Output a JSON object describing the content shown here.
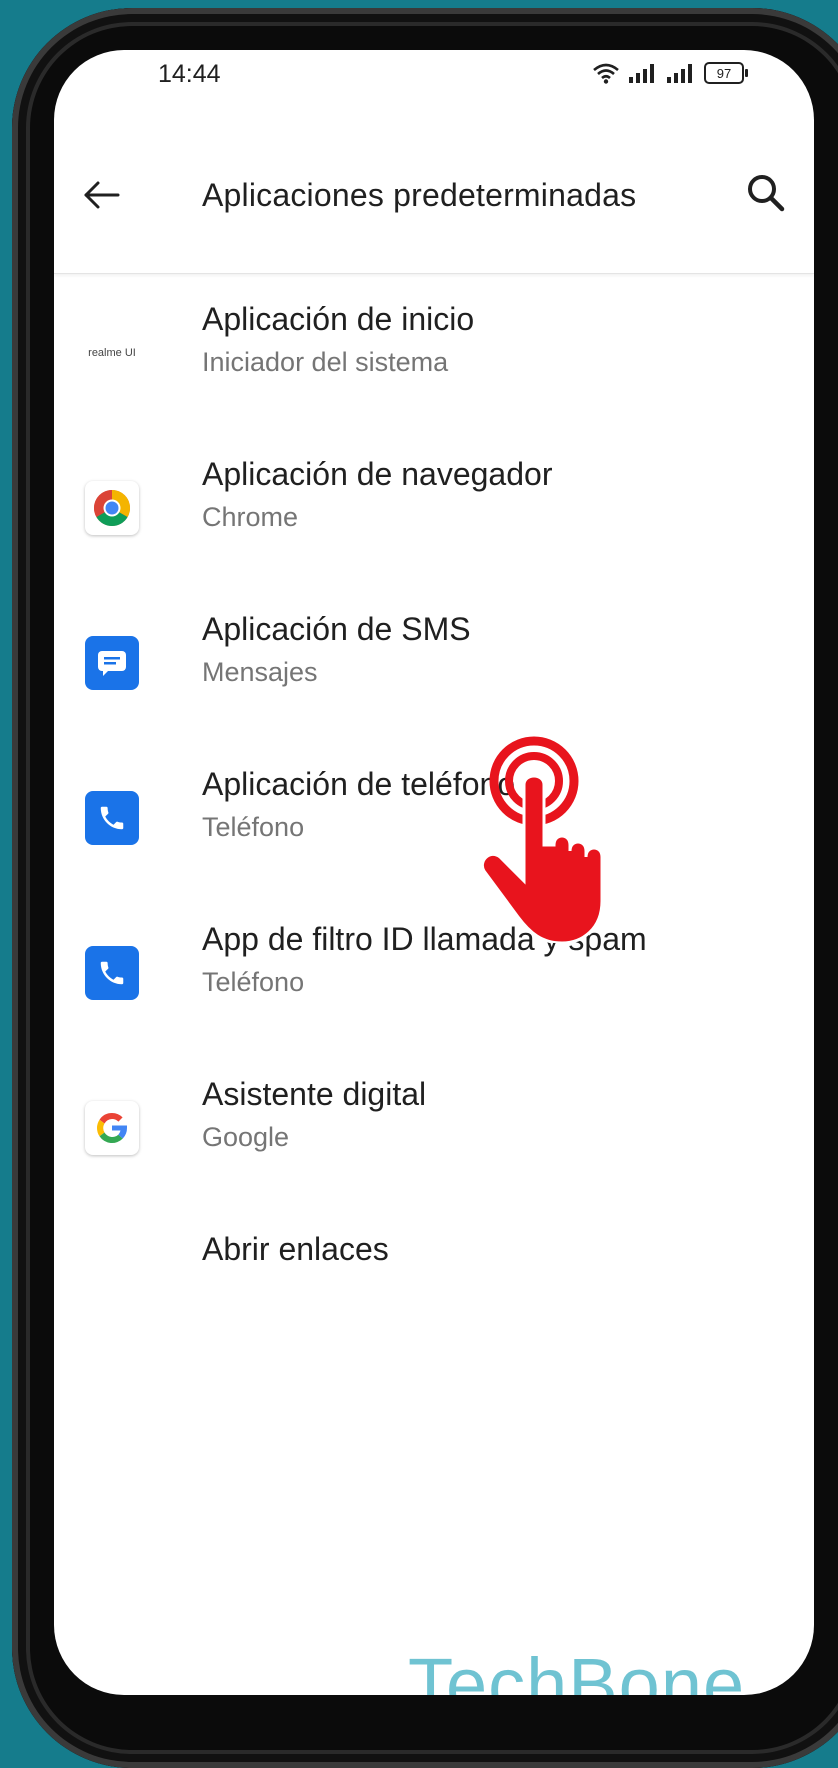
{
  "status_bar": {
    "time": "14:44",
    "battery": "97"
  },
  "app_bar": {
    "title": "Aplicaciones predeterminadas",
    "back_icon": "arrow-back-icon",
    "search_icon": "search-icon"
  },
  "items": [
    {
      "title": "Aplicación de inicio",
      "subtitle": "Iniciador del sistema",
      "icon": "realme-ui-icon",
      "icon_label": "realme UI"
    },
    {
      "title": "Aplicación de navegador",
      "subtitle": "Chrome",
      "icon": "chrome-icon"
    },
    {
      "title": "Aplicación de SMS",
      "subtitle": "Mensajes",
      "icon": "messages-icon"
    },
    {
      "title": "Aplicación de teléfono",
      "subtitle": "Teléfono",
      "icon": "phone-icon"
    },
    {
      "title": "App de filtro ID llamada y spam",
      "subtitle": "Teléfono",
      "icon": "phone-icon"
    },
    {
      "title": "Asistente digital",
      "subtitle": "Google",
      "icon": "google-icon"
    },
    {
      "title": "Abrir enlaces",
      "subtitle": ""
    }
  ],
  "watermark": "TechBone",
  "colors": {
    "background": "#157c8c",
    "accent_blue": "#1a73e8",
    "tap_indicator": "#e8141d",
    "watermark": "#6fc3d2"
  }
}
